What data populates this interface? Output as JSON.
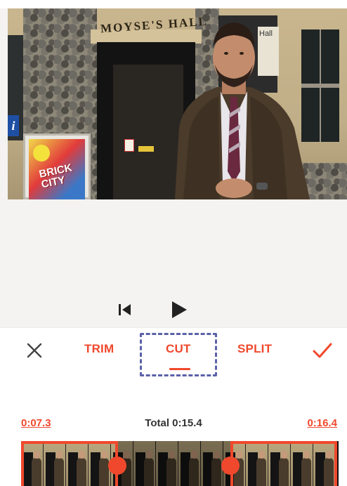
{
  "video": {
    "sign_text": "MOYSE'S HALL",
    "notice_text": "Hall",
    "info_sign": "i",
    "poster_text_1": "BRICK",
    "poster_text_2": "CITY"
  },
  "toolbar": {
    "close_icon": "close-icon",
    "trim_label": "TRIM",
    "cut_label": "CUT",
    "split_label": "SPLIT",
    "confirm_icon": "check-icon",
    "active_tool": "CUT"
  },
  "timeline": {
    "start_time": "0:07.3",
    "total_label": "Total 0:15.4",
    "end_time": "0:16.4"
  },
  "colors": {
    "accent": "#f0482c",
    "highlight": "#5a62a8"
  }
}
